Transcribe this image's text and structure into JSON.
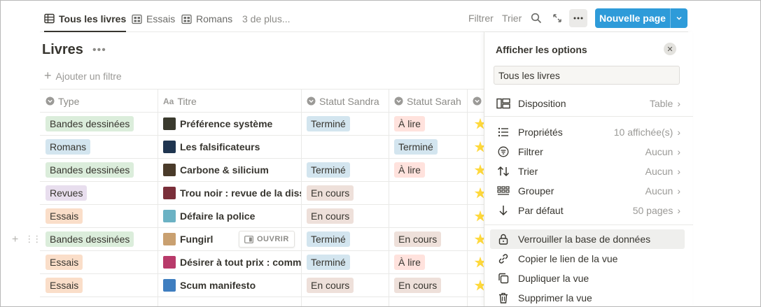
{
  "tabs": [
    {
      "label": "Tous les livres",
      "icon": "table-icon",
      "active": true
    },
    {
      "label": "Essais",
      "icon": "gallery-icon",
      "active": false
    },
    {
      "label": "Romans",
      "icon": "gallery-icon",
      "active": false
    }
  ],
  "more_views": "3 de plus...",
  "toolbar": {
    "filter": "Filtrer",
    "sort": "Trier",
    "new_page": "Nouvelle page"
  },
  "database": {
    "title": "Livres",
    "add_filter": "Ajouter un filtre"
  },
  "columns": [
    "Type",
    "Titre",
    "Statut Sandra",
    "Statut Sarah"
  ],
  "rows": [
    {
      "type": "Bandes dessinées",
      "type_color": "green",
      "title": "Préférence système",
      "thumb": "#3a3a2e",
      "sandra": "Terminé",
      "sandra_color": "blue",
      "sarah": "À lire",
      "sarah_color": "red"
    },
    {
      "type": "Romans",
      "type_color": "blue",
      "title": "Les falsificateurs",
      "thumb": "#1f3550",
      "sandra": "",
      "sandra_color": "",
      "sarah": "Terminé",
      "sarah_color": "blue"
    },
    {
      "type": "Bandes dessinées",
      "type_color": "green",
      "title": "Carbone & silicium",
      "thumb": "#4a3b2a",
      "sandra": "Terminé",
      "sandra_color": "blue",
      "sarah": "À lire",
      "sarah_color": "red"
    },
    {
      "type": "Revues",
      "type_color": "purple",
      "title": "Trou noir : revue de la dissidence",
      "thumb": "#7a2f3a",
      "sandra": "En cours",
      "sandra_color": "brown",
      "sarah": "",
      "sarah_color": ""
    },
    {
      "type": "Essais",
      "type_color": "orange",
      "title": "Défaire la police",
      "thumb": "#6bb2c4",
      "sandra": "En cours",
      "sandra_color": "brown",
      "sarah": "",
      "sarah_color": ""
    },
    {
      "type": "Bandes dessinées",
      "type_color": "green",
      "title": "Fungirl",
      "thumb": "#c9a070",
      "sandra": "Terminé",
      "sandra_color": "blue",
      "sarah": "En cours",
      "sarah_color": "brown"
    },
    {
      "type": "Essais",
      "type_color": "orange",
      "title": "Désirer à tout prix : comment",
      "thumb": "#b83a6a",
      "sandra": "Terminé",
      "sandra_color": "blue",
      "sarah": "À lire",
      "sarah_color": "red"
    },
    {
      "type": "Essais",
      "type_color": "orange",
      "title": "Scum manifesto",
      "thumb": "#3f7ec0",
      "sandra": "En cours",
      "sandra_color": "brown",
      "sarah": "En cours",
      "sarah_color": "brown"
    }
  ],
  "open_button": "OUVRIR",
  "panel": {
    "title": "Afficher les options",
    "view_name": "Tous les livres",
    "items": [
      {
        "label": "Disposition",
        "value": "Table",
        "icon": "layout-icon"
      },
      {
        "label": "Propriétés",
        "value": "10 affichée(s)",
        "icon": "list-icon"
      },
      {
        "label": "Filtrer",
        "value": "Aucun",
        "icon": "filter-icon"
      },
      {
        "label": "Trier",
        "value": "Aucun",
        "icon": "sort-icon"
      },
      {
        "label": "Grouper",
        "value": "Aucun",
        "icon": "group-icon"
      },
      {
        "label": "Par défaut",
        "value": "50 pages",
        "icon": "arrow-down-icon"
      }
    ],
    "actions": [
      {
        "label": "Verrouiller la base de données",
        "icon": "lock-icon"
      },
      {
        "label": "Copier le lien de la vue",
        "icon": "link-icon"
      },
      {
        "label": "Dupliquer la vue",
        "icon": "duplicate-icon"
      },
      {
        "label": "Supprimer la vue",
        "icon": "trash-icon"
      }
    ]
  },
  "colors": {
    "accent": "#2e9bd9"
  }
}
